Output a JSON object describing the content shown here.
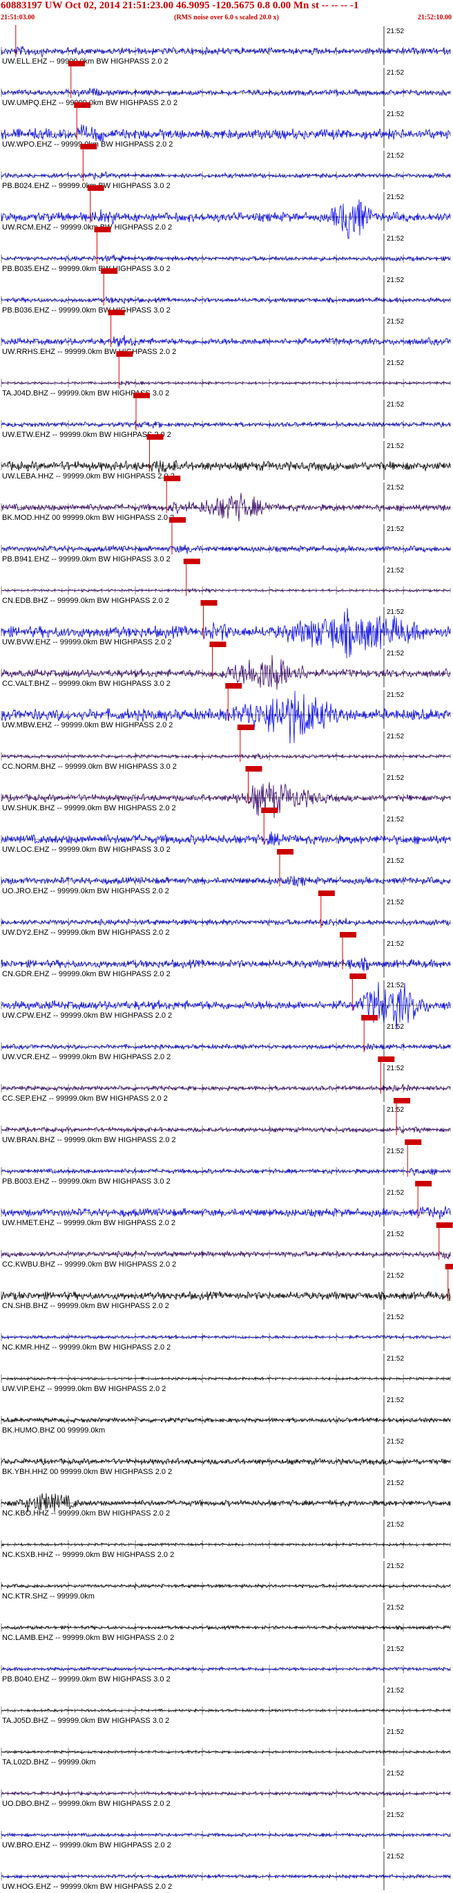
{
  "header": {
    "title": "60883197 UW Oct 02, 2014 21:51:23.00   46.9095 -120.5675  0.8 0.00 Mn st -- -- --  -1",
    "time_start": "21:51:03.00",
    "time_end": "21:52:10.00",
    "rms_note": "(RMS noise over 6.0 s scaled 20.0 x)"
  },
  "minute_label": "21:52",
  "colors": {
    "pick": "#cc0000",
    "pick_line": "#dd0000",
    "grid": "#000000"
  },
  "stations": [
    {
      "label": "UW.ELL.EHZ -- 99999.0km BW  HIGHPASS  2.0  2",
      "color": "#0000cc",
      "amp": 6,
      "pick": 0.032,
      "burst": null
    },
    {
      "label": "UW.UMPQ.EHZ -- 99999.0km BW  HIGHPASS  2.0  2",
      "color": "#0000cc",
      "amp": 5,
      "pick": 0.155,
      "burst": null
    },
    {
      "label": "UW.WPO.EHZ -- 99999.0km BW  HIGHPASS  2.0  2",
      "color": "#0000ee",
      "amp": 9,
      "pick": 0.168,
      "burst": null
    },
    {
      "label": "PB.B024.EHZ -- 99999.0km BW  HIGHPASS  3.0  2",
      "color": "#0000cc",
      "amp": 4,
      "pick": 0.182,
      "burst": null
    },
    {
      "label": "UW.RCM.EHZ -- 99999.0km BW  HIGHPASS  2.0  2",
      "color": "#0000ee",
      "amp": 8,
      "pick": 0.198,
      "burst": [
        0.78,
        0.05,
        3
      ]
    },
    {
      "label": "PB.B035.EHZ -- 99999.0km BW  HIGHPASS  3.0  2",
      "color": "#0000cc",
      "amp": 4,
      "pick": 0.213,
      "burst": null
    },
    {
      "label": "PB.B036.EHZ -- 99999.0km BW  HIGHPASS  3.0  2",
      "color": "#0000cc",
      "amp": 4,
      "pick": 0.228,
      "burst": null
    },
    {
      "label": "UW.RRHS.EHZ -- 99999.0km BW  HIGHPASS  2.0  2",
      "color": "#0000ee",
      "amp": 6,
      "pick": 0.244,
      "burst": null
    },
    {
      "label": "TA.J04D.BHZ -- 99999.0km BW  HIGHPASS  3.0  2",
      "color": "#330066",
      "amp": 2,
      "pick": 0.262,
      "burst": null
    },
    {
      "label": "UW.ETW.EHZ -- 99999.0km BW  HIGHPASS  2.0  2",
      "color": "#0000cc",
      "amp": 4,
      "pick": 0.3,
      "burst": null
    },
    {
      "label": "UW.LEBA.HHZ -- 99999.0km BW  HIGHPASS  2.0  2",
      "color": "#000000",
      "amp": 8,
      "pick": 0.33,
      "burst": null
    },
    {
      "label": "BK.MOD.HHZ 00 99999.0km BW  HIGHPASS  2.0  2",
      "color": "#330066",
      "amp": 6,
      "pick": 0.368,
      "burst": [
        0.52,
        0.1,
        1.8
      ]
    },
    {
      "label": "PB.B941.EHZ -- 99999.0km BW  HIGHPASS  3.0  2",
      "color": "#0000cc",
      "amp": 5,
      "pick": 0.38,
      "burst": null
    },
    {
      "label": "CN.EDB.BHZ -- 99999.0km BW  HIGHPASS  2.0  2",
      "color": "#330066",
      "amp": 2,
      "pick": 0.412,
      "burst": null
    },
    {
      "label": "UW.BVW.EHZ -- 99999.0km BW  HIGHPASS  2.0  2",
      "color": "#0000ee",
      "amp": 10,
      "pick": 0.45,
      "burst": [
        0.78,
        0.18,
        1.6
      ]
    },
    {
      "label": "CC.VALT.BHZ -- 99999.0km BW  HIGHPASS  3.0  2",
      "color": "#330066",
      "amp": 7,
      "pick": 0.47,
      "burst": [
        0.6,
        0.1,
        2.4
      ]
    },
    {
      "label": "UW.MBW.EHZ -- 99999.0km BW  HIGHPASS  2.0  2",
      "color": "#0000ee",
      "amp": 10,
      "pick": 0.505,
      "burst": [
        0.65,
        0.12,
        2.0
      ]
    },
    {
      "label": "CC.NORM.BHZ -- 99999.0km BW  HIGHPASS  3.0  2",
      "color": "#330066",
      "amp": 3,
      "pick": 0.532,
      "burst": null
    },
    {
      "label": "UW.SHUK.BHZ -- 99999.0km BW  HIGHPASS  2.0  2",
      "color": "#330066",
      "amp": 6,
      "pick": 0.55,
      "burst": [
        0.62,
        0.12,
        1.6
      ]
    },
    {
      "label": "UW.LOC.EHZ -- 99999.0km BW  HIGHPASS  3.0  2",
      "color": "#0000ee",
      "amp": 8,
      "pick": 0.585,
      "burst": null
    },
    {
      "label": "UO.JRO.EHZ -- 99999.0km BW  HIGHPASS  2.0  2",
      "color": "#0000cc",
      "amp": 6,
      "pick": 0.62,
      "burst": null
    },
    {
      "label": "UW.DY2.EHZ -- 99999.0km BW  HIGHPASS  2.0  2",
      "color": "#0000cc",
      "amp": 5,
      "pick": 0.712,
      "burst": null
    },
    {
      "label": "CN.GDR.EHZ -- 99999.0km BW  HIGHPASS  2.0  2",
      "color": "#0000cc",
      "amp": 7,
      "pick": 0.76,
      "burst": null
    },
    {
      "label": "UW.CPW.EHZ -- 99999.0km BW  HIGHPASS  2.0  2",
      "color": "#0000ee",
      "amp": 8,
      "pick": 0.782,
      "burst": [
        0.88,
        0.08,
        2.4
      ]
    },
    {
      "label": "UW.VCR.EHZ -- 99999.0km BW  HIGHPASS  2.0  2",
      "color": "#0000cc",
      "amp": 4,
      "pick": 0.808,
      "burst": null
    },
    {
      "label": "CC.SEP.EHZ -- 99999.0km BW  HIGHPASS  2.0  2",
      "color": "#330066",
      "amp": 4,
      "pick": 0.845,
      "burst": null
    },
    {
      "label": "UW.BRAN.BHZ -- 99999.0km BW  HIGHPASS  2.0  2",
      "color": "#330066",
      "amp": 4,
      "pick": 0.88,
      "burst": null
    },
    {
      "label": "PB.B003.EHZ -- 99999.0km BW  HIGHPASS  3.0  2",
      "color": "#0000cc",
      "amp": 4,
      "pick": 0.905,
      "burst": null
    },
    {
      "label": "UW.HMET.EHZ -- 99999.0km BW  HIGHPASS  2.0  2",
      "color": "#0000ee",
      "amp": 7,
      "pick": 0.928,
      "burst": null
    },
    {
      "label": "CC.KWBU.BHZ -- 99999.0km BW  HIGHPASS  2.0  2",
      "color": "#330066",
      "amp": 5,
      "pick": 0.975,
      "burst": null
    },
    {
      "label": "CN.SHB.BHZ -- 99999.0km BW  HIGHPASS  2.0  2",
      "color": "#000000",
      "amp": 7,
      "pick": 0.995,
      "burst": null
    },
    {
      "label": "NC.KMR.HHZ -- 99999.0km BW  HIGHPASS  2.0  2",
      "color": "#0000cc",
      "amp": 3,
      "pick": null,
      "burst": null
    },
    {
      "label": "UW.VIP.EHZ -- 99999.0km BW  HIGHPASS  2.0  2",
      "color": "#000000",
      "amp": 2,
      "pick": null,
      "burst": null
    },
    {
      "label": "BK.HUMO.BHZ 00 99999.0km",
      "color": "#000000",
      "amp": 4,
      "pick": null,
      "burst": null
    },
    {
      "label": "BK.YBH.HHZ 00 99999.0km BW  HIGHPASS  2.0  2",
      "color": "#000000",
      "amp": 5,
      "pick": null,
      "burst": null
    },
    {
      "label": "NC.KBO.HHZ -- 99999.0km BW  HIGHPASS  2.0  2",
      "color": "#000000",
      "amp": 5,
      "pick": null,
      "burst": [
        0.1,
        0.08,
        2.0
      ]
    },
    {
      "label": "NC.KSXB.HHZ -- 99999.0km BW  HIGHPASS  2.0  2",
      "color": "#000000",
      "amp": 2,
      "pick": null,
      "burst": null
    },
    {
      "label": "NC.KTR.SHZ -- 99999.0km",
      "color": "#000000",
      "amp": 3,
      "pick": null,
      "burst": null
    },
    {
      "label": "NC.LAMB.EHZ -- 99999.0km BW  HIGHPASS  2.0  2",
      "color": "#000000",
      "amp": 3,
      "pick": null,
      "burst": null
    },
    {
      "label": "PB.B040.EHZ -- 99999.0km BW  HIGHPASS  3.0  2",
      "color": "#0000cc",
      "amp": 3,
      "pick": null,
      "burst": null
    },
    {
      "label": "TA.J05D.BHZ -- 99999.0km BW  HIGHPASS  3.0  2",
      "color": "#000000",
      "amp": 2,
      "pick": null,
      "burst": null
    },
    {
      "label": "TA.L02D.BHZ -- 99999.0km",
      "color": "#000000",
      "amp": 2,
      "pick": null,
      "burst": null
    },
    {
      "label": "UO.DBO.BHZ -- 99999.0km BW  HIGHPASS  2.0  2",
      "color": "#330066",
      "amp": 3,
      "pick": null,
      "burst": null
    },
    {
      "label": "UW.BRO.EHZ -- 99999.0km BW  HIGHPASS  2.0  2",
      "color": "#0000cc",
      "amp": 3,
      "pick": null,
      "burst": null
    },
    {
      "label": "UW.HOG.EHZ -- 99999.0km BW  HIGHPASS  2.0  2",
      "color": "#0000cc",
      "amp": 3,
      "pick": null,
      "burst": null
    }
  ]
}
